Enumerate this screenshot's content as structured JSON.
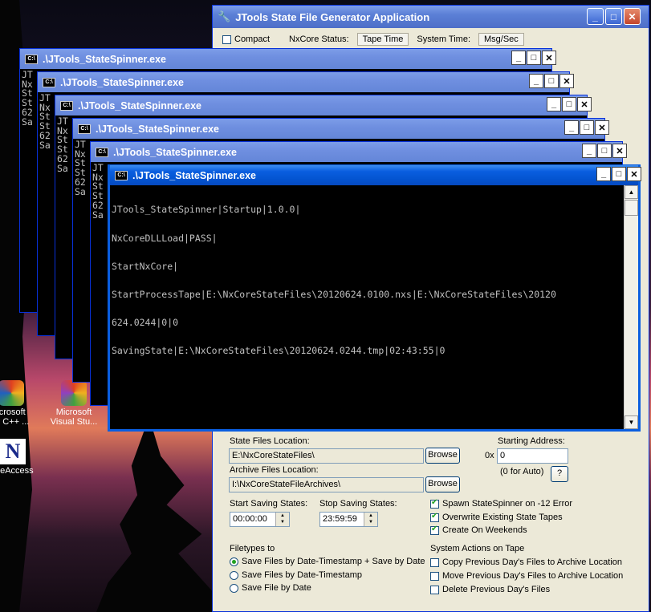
{
  "app": {
    "title": "JTools State File Generator Application",
    "toolbar": {
      "compact_label": "Compact",
      "compact_checked": false,
      "nxcore_status": "NxCore Status:",
      "tape_time": "Tape Time",
      "system_time": "System Time:",
      "msg_sec": "Msg/Sec"
    },
    "form": {
      "state_files_label": "State Files Location:",
      "state_files_value": "E:\\NxCoreStateFiles\\",
      "archive_files_label": "Archive Files Location:",
      "archive_files_value": "I:\\NxCoreStateFileArchives\\",
      "browse_label": "Browse",
      "starting_address_label": "Starting Address:",
      "address_prefix": "0x",
      "address_value": "0",
      "auto_hint": "(0 for Auto)",
      "help_label": "?",
      "start_saving_label": "Start Saving States:",
      "start_saving_value": "00:00:00",
      "stop_saving_label": "Stop Saving States:",
      "stop_saving_value": "23:59:59",
      "spawn_label": "Spawn StateSpinner on -12 Error",
      "overwrite_label": "Overwrite Existing State Tapes",
      "weekends_label": "Create On Weekends",
      "filetypes_label": "Filetypes to",
      "radio1": "Save Files by Date-Timestamp + Save by Date",
      "radio2": "Save Files by Date-Timestamp",
      "radio3": "Save File by Date",
      "system_actions_label": "System Actions on Tape",
      "copy_prev": "Copy Previous Day's Files to Archive Location",
      "move_prev": "Move Previous Day's Files to Archive Location",
      "delete_prev": "Delete Previous Day's Files"
    }
  },
  "console": {
    "title": ".\\JTools_StateSpinner.exe",
    "peek_lines": [
      "JT",
      "Nx",
      "St",
      "St",
      "62",
      "Sa"
    ],
    "lines": [
      "JTools_StateSpinner|Startup|1.0.0|",
      "NxCoreDLLLoad|PASS|",
      "StartNxCore|",
      "StartProcessTape|E:\\NxCoreStateFiles\\20120624.0100.nxs|E:\\NxCoreStateFiles\\20120",
      "624.0244|0|0",
      "SavingState|E:\\NxCoreStateFiles\\20120624.0244.tmp|02:43:55|0"
    ]
  },
  "desktop": {
    "icons": [
      {
        "label1": "icrosoft",
        "label2": "al C++ ..."
      },
      {
        "label1": "Microsoft",
        "label2": "Visual Stu..."
      },
      {
        "label1": "",
        "label2": "oreAccess"
      }
    ]
  }
}
